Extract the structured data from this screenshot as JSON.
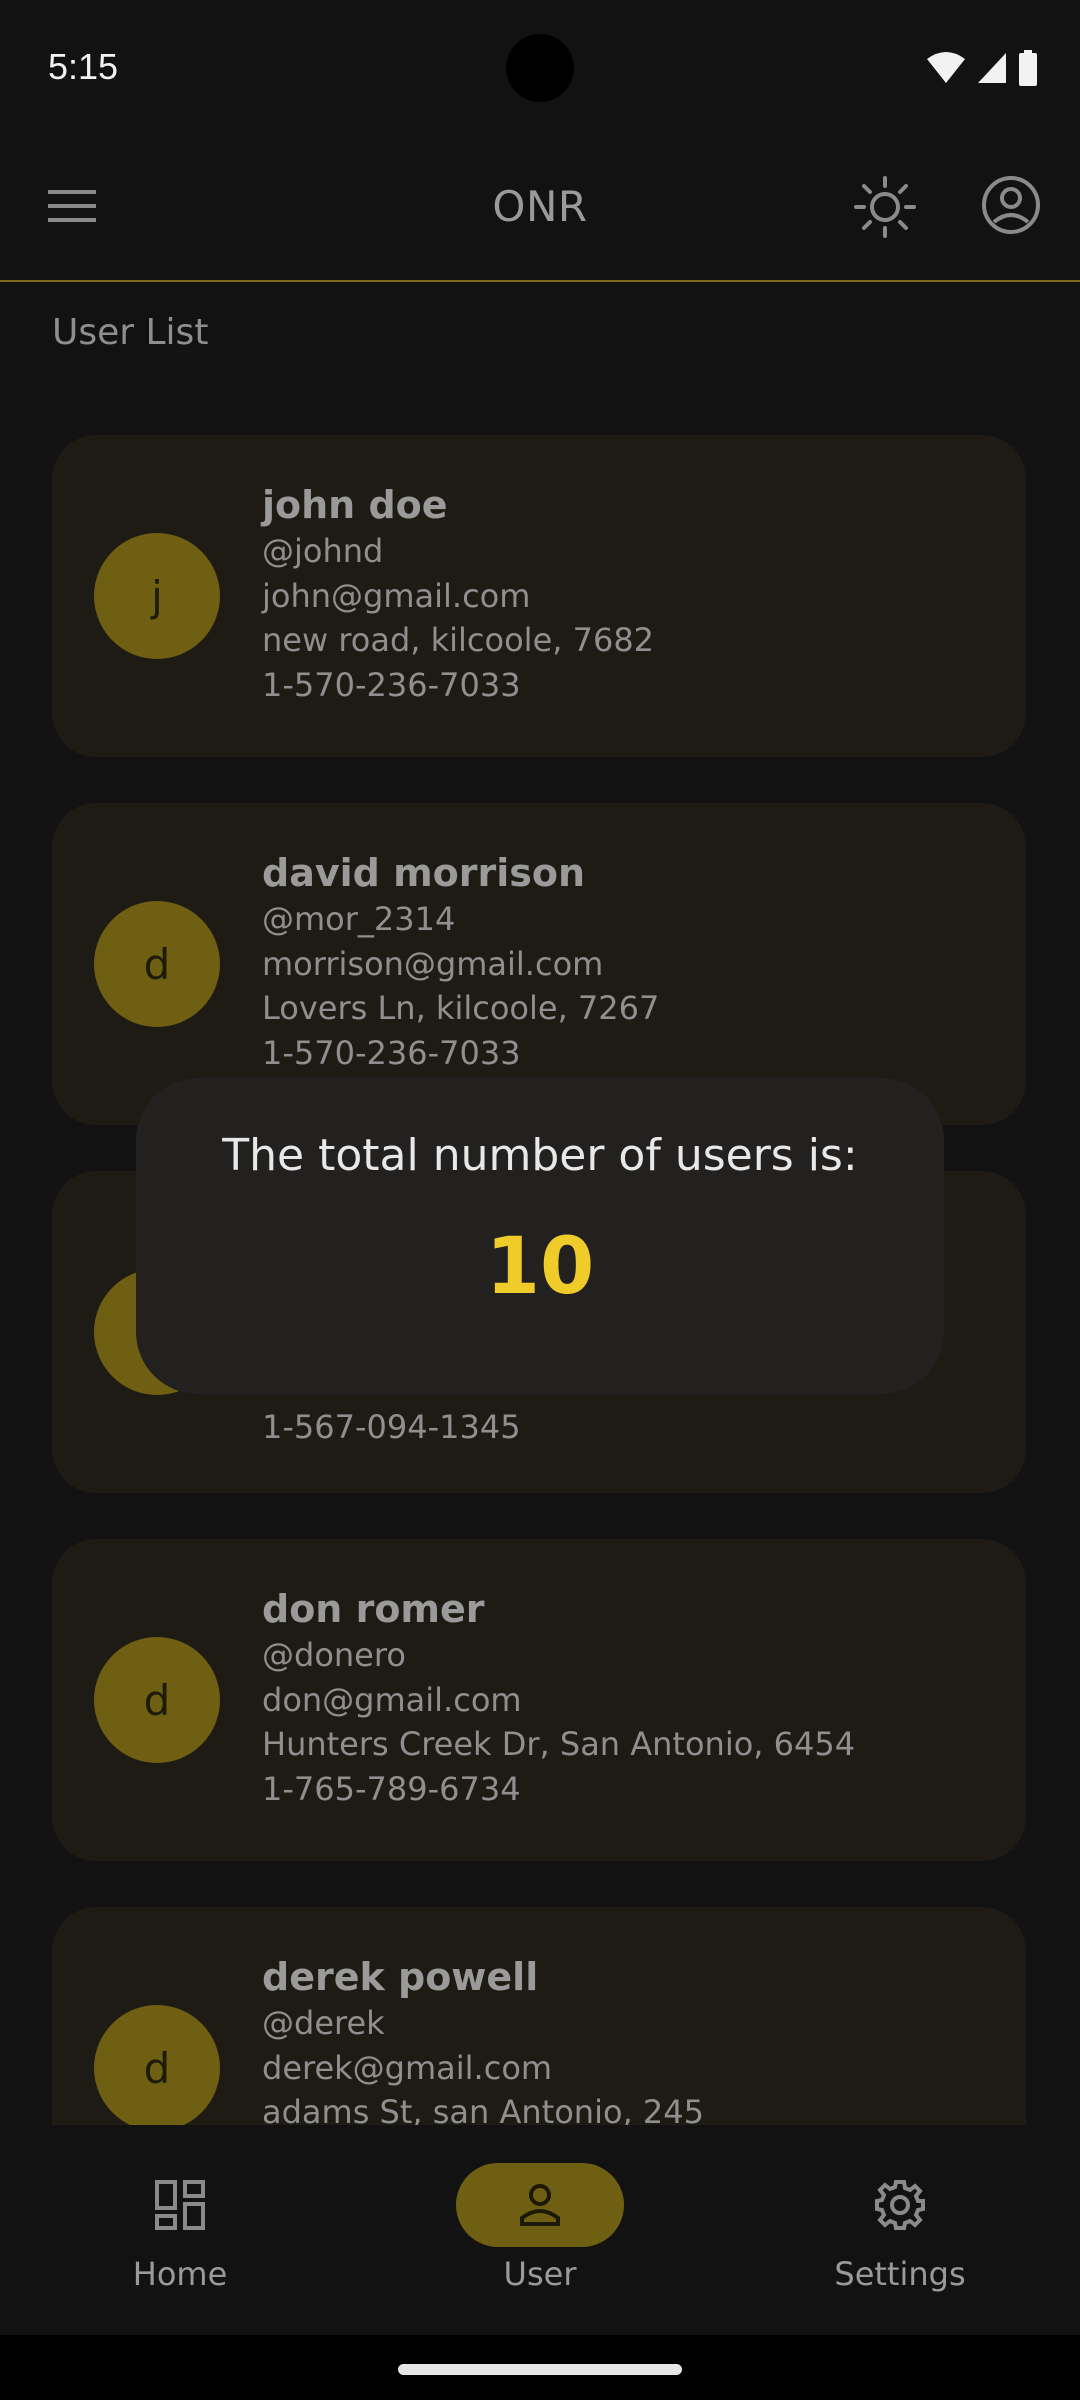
{
  "status_bar": {
    "time": "5:15"
  },
  "app_bar": {
    "title": "ONR"
  },
  "section_title": "User List",
  "users": [
    {
      "initial": "j",
      "name": "john doe",
      "username": "@johnd",
      "email": "john@gmail.com",
      "address": "new road, kilcoole, 7682",
      "phone": "1-570-236-7033"
    },
    {
      "initial": "d",
      "name": "david morrison",
      "username": "@mor_2314",
      "email": "morrison@gmail.com",
      "address": "Lovers Ln, kilcoole, 7267",
      "phone": "1-570-236-7033"
    },
    {
      "initial": "",
      "name": "",
      "username": "",
      "email": "",
      "address": "",
      "phone": "1-567-094-1345"
    },
    {
      "initial": "d",
      "name": "don romer",
      "username": "@donero",
      "email": "don@gmail.com",
      "address": "Hunters Creek Dr, San Antonio, 6454",
      "phone": "1-765-789-6734"
    },
    {
      "initial": "d",
      "name": "derek powell",
      "username": "@derek",
      "email": "derek@gmail.com",
      "address": "adams St, san Antonio, 245",
      "phone": ""
    }
  ],
  "dialog": {
    "text": "The total number of users is:",
    "count": "10"
  },
  "bottom_nav": {
    "items": [
      {
        "label": "Home",
        "icon": "dashboard-icon"
      },
      {
        "label": "User",
        "icon": "person-icon"
      },
      {
        "label": "Settings",
        "icon": "settings-icon"
      }
    ],
    "active": "User"
  },
  "colors": {
    "accent": "#f0cc2a",
    "avatar_bg": "#6f5f12",
    "card_bg": "#1d1b14",
    "background": "#121212"
  }
}
